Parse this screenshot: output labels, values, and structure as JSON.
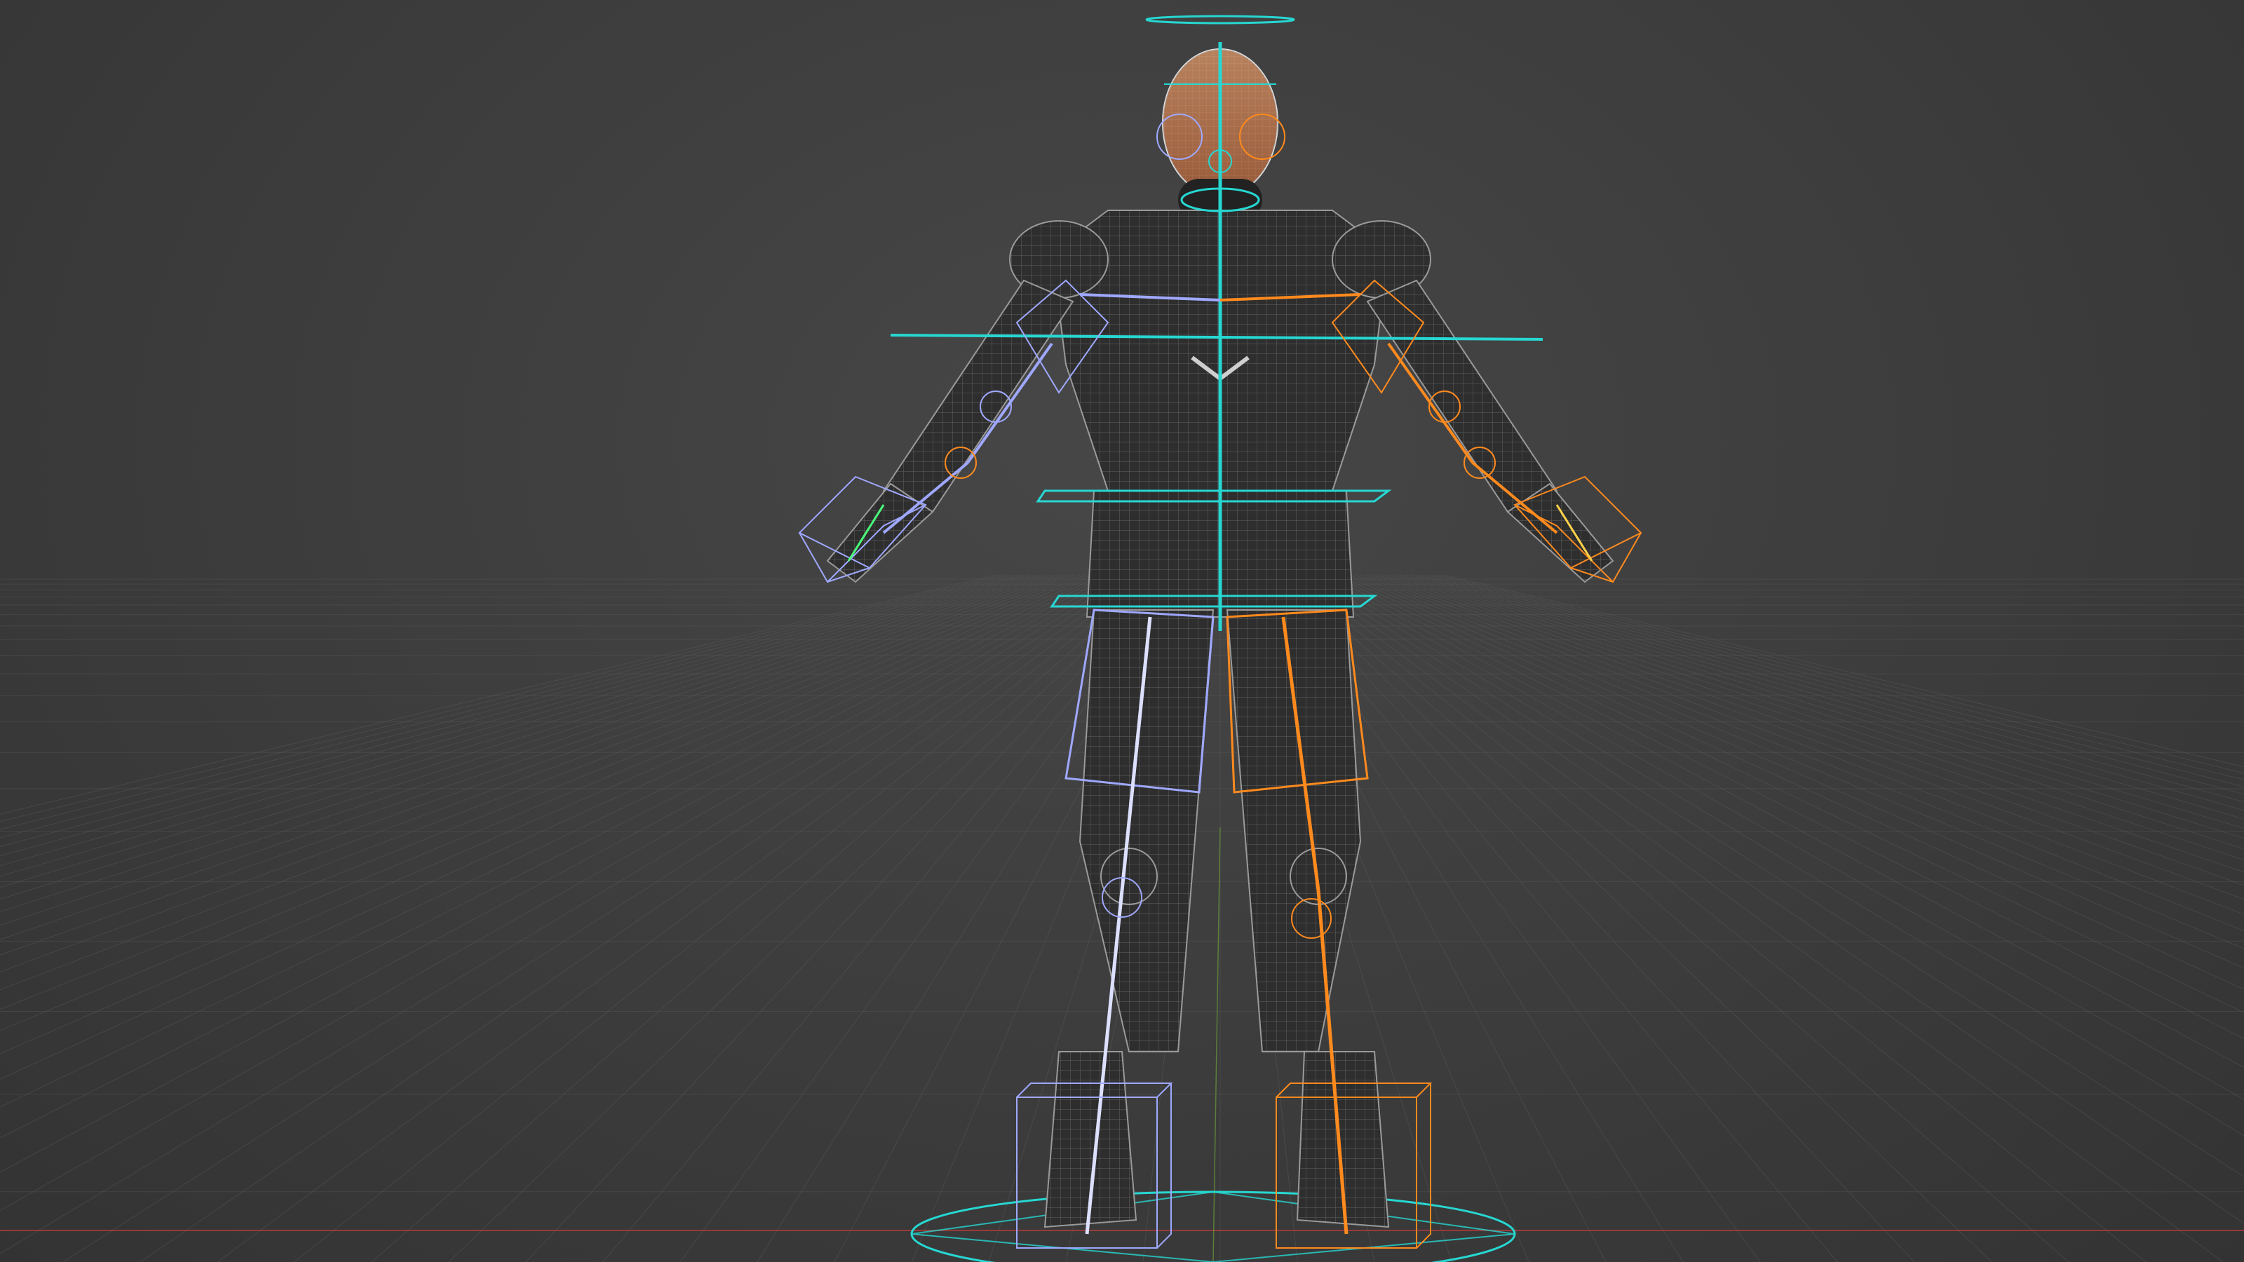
{
  "viewport": {
    "background_color": "#3f3f3f",
    "grid_color": "#5a5a5a",
    "x_axis_color": "#b03a3a",
    "y_axis_color": "#6a9a3a"
  },
  "rig": {
    "center_color": "#27d7d2",
    "left_color": "#9fa8ff",
    "right_color": "#ff8a1e",
    "mesh_color": "#2b2b2b",
    "mesh_line_color": "#8a8a8a",
    "face_color": "#d9804a"
  }
}
